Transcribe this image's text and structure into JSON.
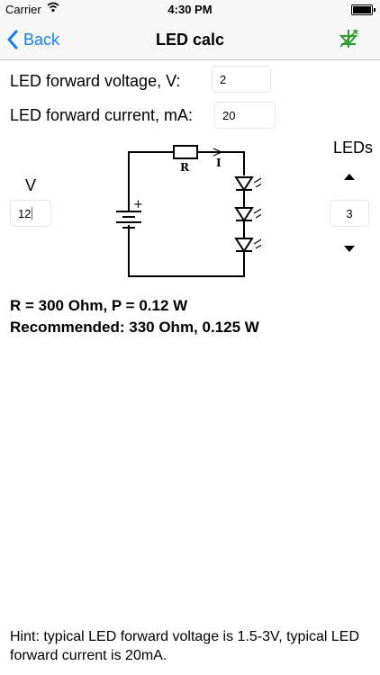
{
  "status": {
    "carrier": "Carrier",
    "time": "4:30 PM"
  },
  "nav": {
    "back_label": "Back",
    "title": "LED calc"
  },
  "form": {
    "voltage_label": "LED forward voltage, V:",
    "voltage_value": "2",
    "current_label": "LED forward current, mA:",
    "current_value": "20"
  },
  "supply": {
    "label": "V",
    "value": "12"
  },
  "leds": {
    "label": "LEDs",
    "value": "3"
  },
  "diagram": {
    "resistor_label": "R",
    "current_label": "I",
    "battery_plus": "+"
  },
  "results": {
    "line1": "R = 300 Ohm, P = 0.12 W",
    "line2": "Recommended: 330 Ohm, 0.125 W"
  },
  "hint": "Hint: typical LED forward voltage is 1.5-3V, typical LED forward current is 20mA.",
  "colors": {
    "accent": "#157efb",
    "icon_green": "#2e9b2e"
  }
}
